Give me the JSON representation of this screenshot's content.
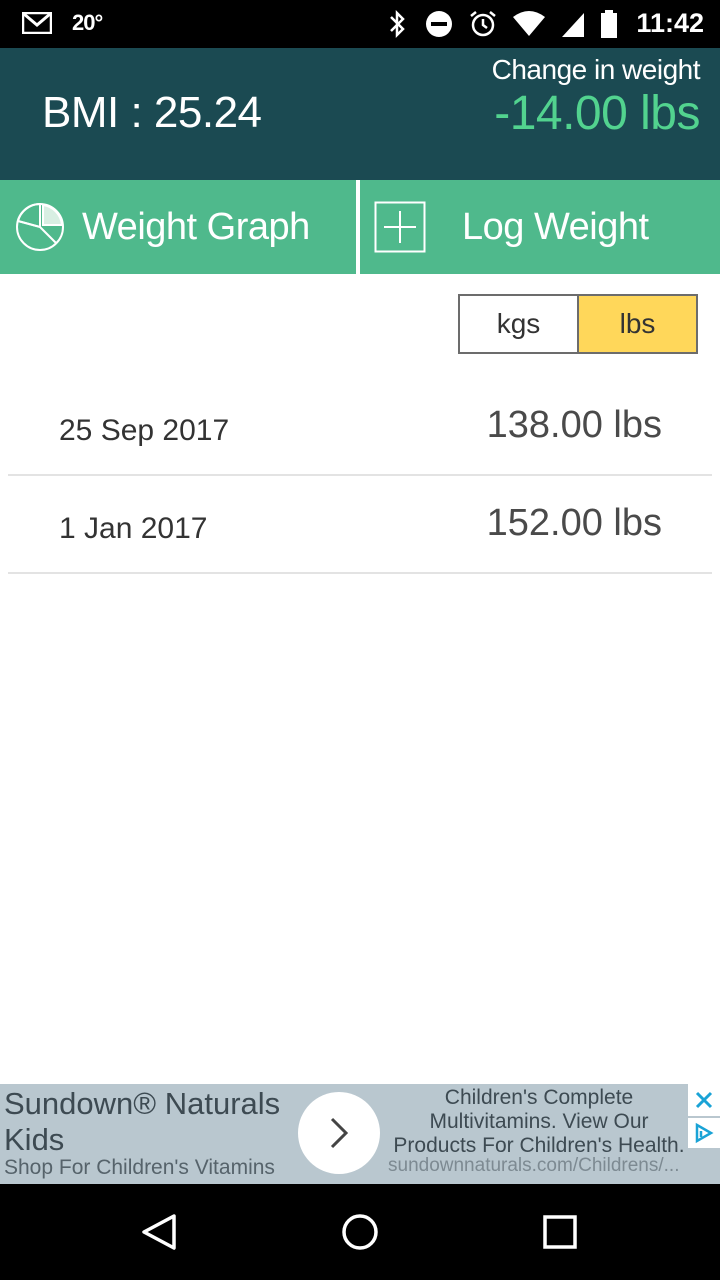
{
  "status_bar": {
    "temperature": "20°",
    "time": "11:42",
    "icons": [
      "gmail-icon",
      "bluetooth-icon",
      "do-not-disturb-icon",
      "alarm-icon",
      "wifi-icon",
      "cell-signal-icon",
      "battery-icon"
    ]
  },
  "header": {
    "bmi_text": "BMI : 25.24",
    "change_label": "Change in weight",
    "change_value": "-14.00 lbs",
    "colors": {
      "background": "#1b4a52",
      "change_value": "#52d38f"
    }
  },
  "actions": {
    "graph_label": "Weight Graph",
    "log_label": "Log Weight",
    "color": "#4fb98c"
  },
  "unit_toggle": {
    "options": [
      "kgs",
      "lbs"
    ],
    "selected": "lbs",
    "selected_color": "#ffd75a"
  },
  "entries": [
    {
      "date": "25 Sep 2017",
      "weight": "138.00 lbs"
    },
    {
      "date": "1 Jan 2017",
      "weight": "152.00 lbs"
    }
  ],
  "ad": {
    "title": "Sundown® Naturals Kids",
    "subtitle": "Shop For Children's Vitamins",
    "description": "Children's Complete Multivitamins. View Our Products For Children's Health.",
    "url": "sundownnaturals.com/Childrens/..."
  },
  "nav": {
    "icons": [
      "back-icon",
      "home-icon",
      "recent-apps-icon"
    ]
  }
}
